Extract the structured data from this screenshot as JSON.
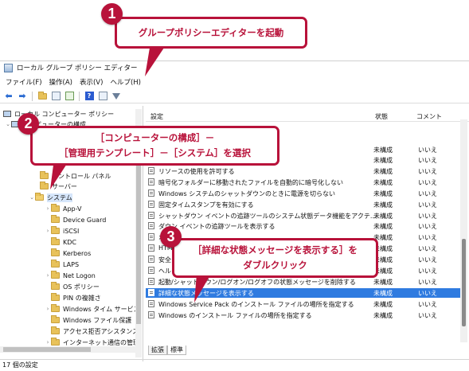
{
  "window": {
    "title": "ローカル グループ ポリシー エディター",
    "menu": [
      "ファイル(F)",
      "操作(A)",
      "表示(V)",
      "ヘルプ(H)"
    ]
  },
  "tree": {
    "root": "ローカル コンピューター ポリシー",
    "computer_config": "コンピューターの構成",
    "items": [
      "コントロール パネル",
      "サーバー",
      "システム",
      "App-V",
      "Device Guard",
      "iSCSI",
      "KDC",
      "Kerberos",
      "LAPS",
      "Net Logon",
      "OS ポリシー",
      "PIN の複雑さ",
      "Windows タイム サービス",
      "Windows ファイル保護",
      "アクセス拒否アシスタンス",
      "インターネット通信の管理"
    ]
  },
  "list": {
    "columns": {
      "setting": "設定",
      "state": "状態",
      "comment": "コメント"
    },
    "rows": [
      {
        "setting": "ロードする",
        "state": "未構成",
        "comment": "いいえ"
      },
      {
        "setting": "合にメッセージを表示に",
        "state": "未構成",
        "comment": "いいえ"
      },
      {
        "setting": "リソースの使用を許可する",
        "state": "未構成",
        "comment": "いいえ"
      },
      {
        "setting": "暗号化フォルダーに移動されたファイルを自動的に暗号化しない",
        "state": "未構成",
        "comment": "いいえ"
      },
      {
        "setting": "Windows システムのシャットダウンのときに電源を切らない",
        "state": "未構成",
        "comment": "いいえ"
      },
      {
        "setting": "固定タイムスタンプを有効にする",
        "state": "未構成",
        "comment": "いいえ"
      },
      {
        "setting": "シャットダウン イベントの追跡ツールのシステム状態データ機能をアクテ...",
        "state": "未構成",
        "comment": "いいえ"
      },
      {
        "setting": "ダウン イベントの追跡ツールを表示する",
        "state": "未構成",
        "comment": "いいえ"
      },
      {
        "setting": "オ",
        "state": "未構成",
        "comment": "いいえ"
      },
      {
        "setting": "HTM",
        "state": "未構成",
        "comment": "いいえ"
      },
      {
        "setting": "安全",
        "state": "未構成",
        "comment": "いいえ"
      },
      {
        "setting": "ヘル",
        "state": "未構成",
        "comment": "いいえ"
      },
      {
        "setting": "起動/シャットダウン/ログオン/ログオフの状態メッセージを削除する",
        "state": "未構成",
        "comment": "いいえ"
      },
      {
        "setting": "詳細な状態メッセージを表示する",
        "state": "未構成",
        "comment": "いいえ"
      },
      {
        "setting": "Windows Service Pack のインストール ファイルの場所を指定する",
        "state": "未構成",
        "comment": "いいえ"
      },
      {
        "setting": "Windows のインストール ファイルの場所を指定する",
        "state": "未構成",
        "comment": "いいえ"
      }
    ]
  },
  "tabs": [
    "拡張",
    "標準"
  ],
  "status": "17 個の設定",
  "callouts": {
    "c1": {
      "num": "1",
      "text": "グループポリシーエディターを起動"
    },
    "c2": {
      "num": "2",
      "line1": "［コンピューターの構成］－",
      "line2": "［管理用テンプレート］－［システム］を選択"
    },
    "c3": {
      "num": "3",
      "line1": "［詳細な状態メッセージを表示する］を",
      "line2": "ダブルクリック"
    }
  },
  "colors": {
    "accent": "#b8123a",
    "selection": "#2f7be0"
  }
}
